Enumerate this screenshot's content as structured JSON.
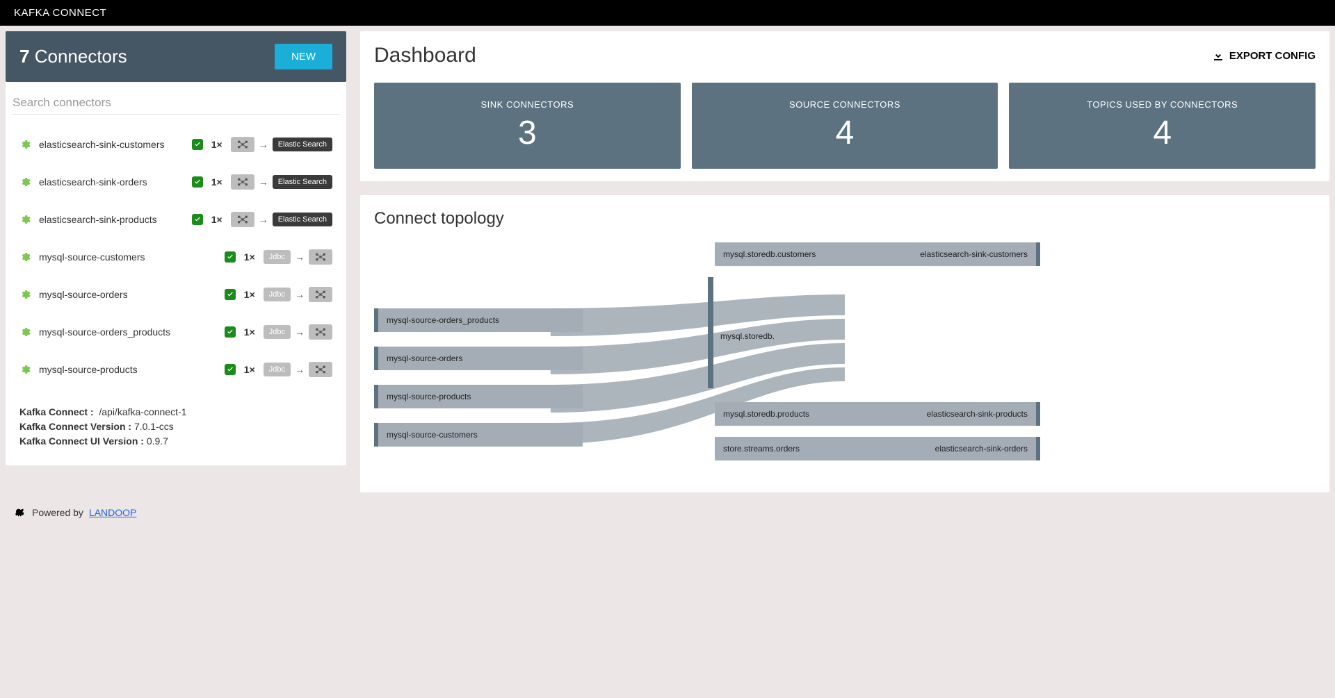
{
  "header": {
    "title": "KAFKA CONNECT"
  },
  "sidebar": {
    "count": "7",
    "title": "Connectors",
    "new_label": "NEW",
    "search_placeholder": "Search connectors",
    "connectors": [
      {
        "name": "elasticsearch-sink-customers",
        "count": "1",
        "type": "sink",
        "sink_label": "Elastic Search"
      },
      {
        "name": "elasticsearch-sink-orders",
        "count": "1",
        "type": "sink",
        "sink_label": "Elastic Search"
      },
      {
        "name": "elasticsearch-sink-products",
        "count": "1",
        "type": "sink",
        "sink_label": "Elastic Search"
      },
      {
        "name": "mysql-source-customers",
        "count": "1",
        "type": "source",
        "source_label": "Jdbc"
      },
      {
        "name": "mysql-source-orders",
        "count": "1",
        "type": "source",
        "source_label": "Jdbc"
      },
      {
        "name": "mysql-source-orders_products",
        "count": "1",
        "type": "source",
        "source_label": "Jdbc"
      },
      {
        "name": "mysql-source-products",
        "count": "1",
        "type": "source",
        "source_label": "Jdbc"
      }
    ]
  },
  "info": {
    "kc_label": "Kafka Connect :",
    "kc_value": "/api/kafka-connect-1",
    "kcv_label": "Kafka Connect Version :",
    "kcv_value": "7.0.1-ccs",
    "kcui_label": "Kafka Connect UI Version :",
    "kcui_value": "0.9.7"
  },
  "main": {
    "title": "Dashboard",
    "export_label": "EXPORT CONFIG",
    "stats": [
      {
        "label": "SINK CONNECTORS",
        "value": "3"
      },
      {
        "label": "SOURCE CONNECTORS",
        "value": "4"
      },
      {
        "label": "TOPICS USED BY CONNECTORS",
        "value": "4"
      }
    ],
    "topology_title": "Connect topology",
    "topology": {
      "left": [
        {
          "label": "mysql-source-orders_products"
        },
        {
          "label": "mysql-source-orders"
        },
        {
          "label": "mysql-source-products"
        },
        {
          "label": "mysql-source-customers"
        }
      ],
      "mid": {
        "label": "mysql.storedb."
      },
      "right": [
        {
          "topic": "mysql.storedb.customers",
          "sink": "elasticsearch-sink-customers"
        },
        {
          "topic": "mysql.storedb.products",
          "sink": "elasticsearch-sink-products"
        },
        {
          "topic": "store.streams.orders",
          "sink": "elasticsearch-sink-orders"
        }
      ]
    }
  },
  "footer": {
    "text": "Powered by",
    "link": "LANDOOP"
  },
  "x": "×"
}
